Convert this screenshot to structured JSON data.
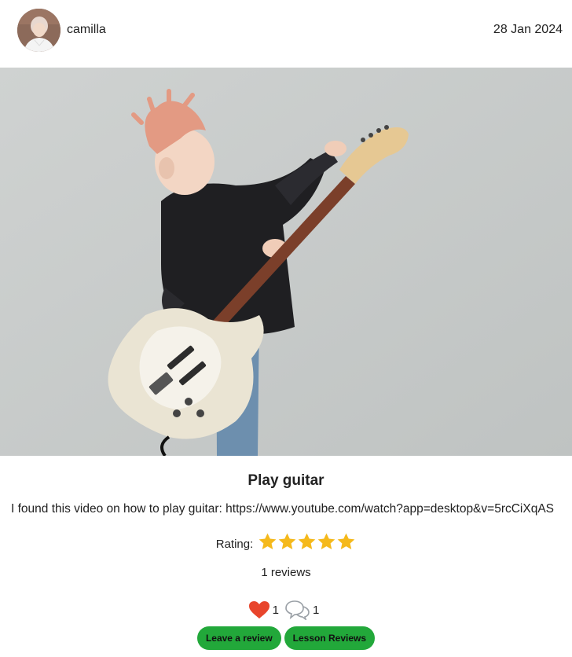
{
  "post": {
    "username": "camilla",
    "date": "28 Jan 2024",
    "title": "Play guitar",
    "description": "I found this video on how to play guitar: https://www.youtube.com/watch?app=desktop&v=5rcCiXqAS",
    "rating_label": "Rating:",
    "rating": 5,
    "rating_max": 5,
    "reviews_count": "1 reviews",
    "likes": "1",
    "comments": "1"
  },
  "actions": {
    "leave_review": "Leave a review",
    "lesson_reviews": "Lesson Reviews"
  },
  "icons": {
    "like": "heart-icon",
    "comment": "chat-bubbles-icon",
    "rating": "star-icon"
  },
  "colors": {
    "star": "#f5b91b",
    "heart": "#e8452c",
    "button": "#22a83a"
  }
}
